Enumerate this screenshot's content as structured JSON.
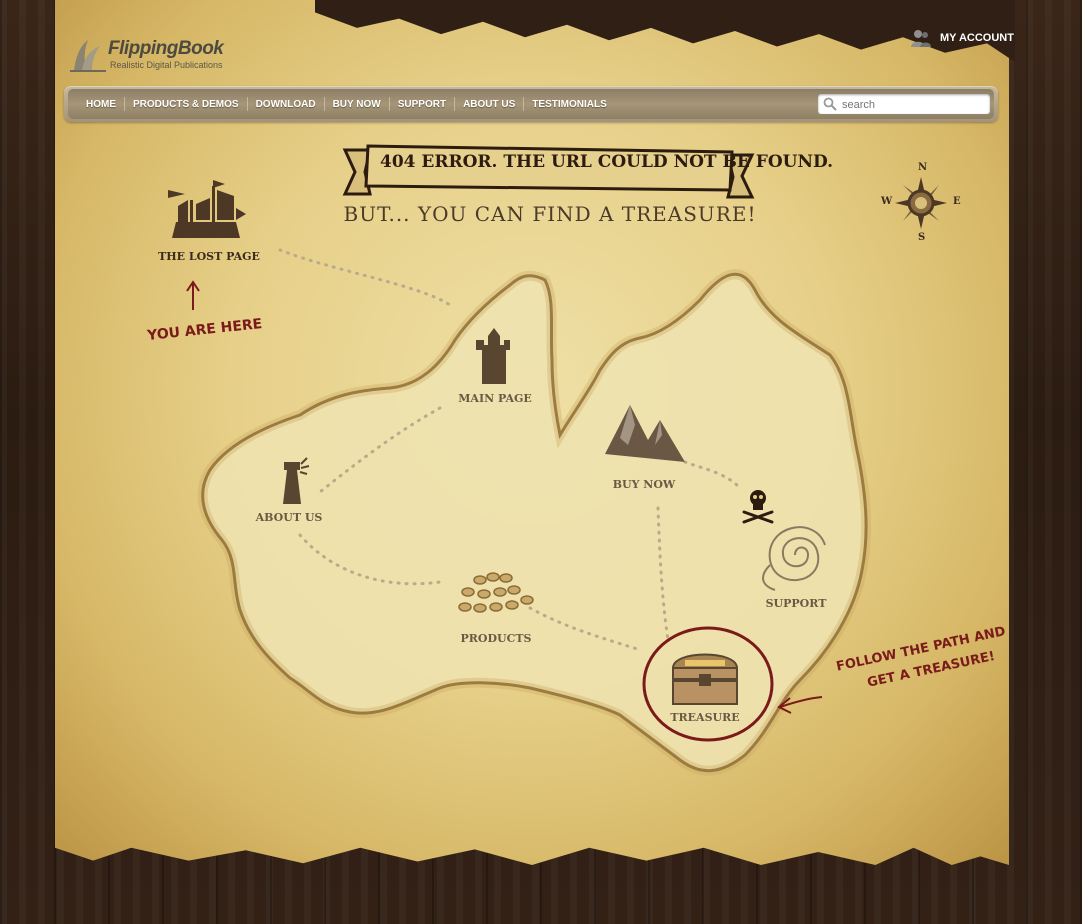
{
  "header": {
    "logo_title": "FlippingBook",
    "logo_subtitle": "Realistic Digital Publications",
    "account_label": "MY ACCOUNT"
  },
  "nav": {
    "items": [
      "HOME",
      "PRODUCTS & DEMOS",
      "DOWNLOAD",
      "BUY NOW",
      "SUPPORT",
      "ABOUT US",
      "TESTIMONIALS"
    ]
  },
  "search": {
    "placeholder": "search"
  },
  "error": {
    "banner": "404 ERROR. THE URL COULD NOT BE FOUND.",
    "subtitle": "BUT... YOU CAN FIND A TREASURE!"
  },
  "map": {
    "lost_page": "THE LOST PAGE",
    "you_are_here": "YOU ARE HERE",
    "main_page": "MAIN PAGE",
    "about_us": "ABOUT US",
    "buy_now": "BUY NOW",
    "products": "PRODUCTS",
    "support": "SUPPORT",
    "treasure": "TREASURE",
    "follow_line1": "FOLLOW THE PATH AND",
    "follow_line2": "GET A TREASURE!"
  },
  "compass": {
    "n": "N",
    "s": "S",
    "e": "E",
    "w": "W"
  },
  "colors": {
    "ink": "#7a1a1a",
    "nav": "#a69677",
    "parchment": "#e6cf88"
  }
}
